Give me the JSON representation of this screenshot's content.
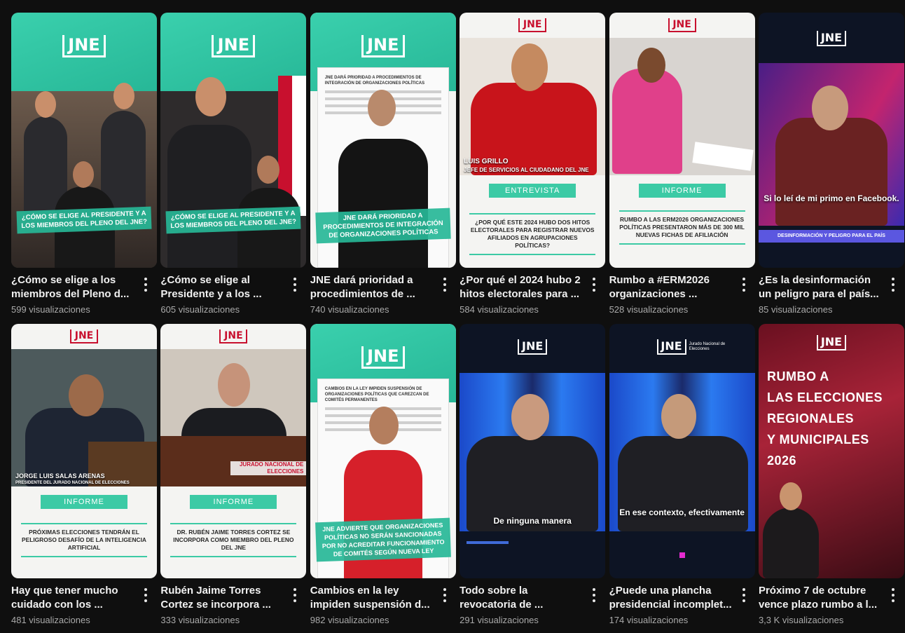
{
  "videos": [
    {
      "title": "¿Cómo se elige a los miembros del Pleno d...",
      "views": "599 visualizaciones",
      "thumb": {
        "logo": "JNE",
        "banner": "¿CÓMO SE ELIGE AL PRESIDENTE Y A LOS MIEMBROS DEL PLENO DEL JNE?"
      }
    },
    {
      "title": "¿Cómo se elige al Presidente y a los ...",
      "views": "605 visualizaciones",
      "thumb": {
        "logo": "JNE",
        "banner": "¿CÓMO SE ELIGE AL PRESIDENTE Y A LOS MIEMBROS DEL PLENO DEL JNE?"
      }
    },
    {
      "title": "JNE dará prioridad a procedimientos de ...",
      "views": "740 visualizaciones",
      "thumb": {
        "logo": "JNE",
        "doc_header": "JNE DARÁ PRIORIDAD A PROCEDIMIENTOS DE INTEGRACIÓN DE ORGANIZACIONES POLÍTICAS",
        "banner": "JNE DARÁ PRIORIDAD A PROCEDIMIENTOS DE INTEGRACIÓN DE ORGANIZACIONES POLÍTICAS"
      }
    },
    {
      "title": "¿Por qué el 2024 hubo 2 hitos electorales para ...",
      "views": "584 visualizaciones",
      "thumb": {
        "logo": "JNE",
        "caption": "LUIS GRILLO",
        "caption2": "JEFE DE SERVICIOS AL CIUDADANO DEL JNE",
        "pill": "ENTREVISTA",
        "info": "¿POR QUÉ ESTE 2024 HUBO DOS HITOS ELECTORALES PARA REGISTRAR NUEVOS AFILIADOS EN AGRUPACIONES POLÍTICAS?"
      }
    },
    {
      "title": "Rumbo a #ERM2026 organizaciones ...",
      "views": "528 visualizaciones",
      "thumb": {
        "logo": "JNE",
        "pill": "INFORME",
        "info": "RUMBO A LAS ERM2026 ORGANIZACIONES POLÍTICAS PRESENTARON MÁS DE 300 MIL NUEVAS FICHAS DE AFILIACIÓN"
      }
    },
    {
      "title": "¿Es la desinformación un peligro para el país...",
      "views": "85 visualizaciones",
      "thumb": {
        "logo": "JNE",
        "subtitle": "Si lo leí de mi primo en Facebook.",
        "strap": "DESINFORMACIÓN Y PELIGRO PARA EL PAÍS"
      }
    },
    {
      "title": "Hay que tener mucho cuidado con los ...",
      "views": "481 visualizaciones",
      "thumb": {
        "logo": "JNE",
        "caption": "JORGE LUIS SALAS ARENAS",
        "caption2": "PRESIDENTE DEL JURADO NACIONAL DE ELECCIONES",
        "pill": "INFORME",
        "info": "PRÓXIMAS ELECCIONES TENDRÁN EL PELIGROSO DESAFÍO DE LA INTELIGENCIA ARTIFICIAL"
      }
    },
    {
      "title": "Rubén Jaime Torres Cortez se incorpora ...",
      "views": "333 visualizaciones",
      "thumb": {
        "logo": "JNE",
        "podium": "JURADO NACIONAL DE ELECCIONES",
        "pill": "INFORME",
        "info": "DR. RUBÉN JAIME TORRES CORTEZ SE INCORPORA COMO MIEMBRO DEL PLENO DEL JNE"
      }
    },
    {
      "title": "Cambios en la ley impiden suspensión d...",
      "views": "982 visualizaciones",
      "thumb": {
        "logo": "JNE",
        "doc_header": "CAMBIOS EN LA LEY IMPIDEN SUSPENSIÓN DE ORGANIZACIONES POLÍTICAS QUE CAREZCAN DE COMITÉS PERMANENTES",
        "banner": "JNE ADVIERTE QUE ORGANIZACIONES POLÍTICAS NO SERÁN SANCIONADAS POR NO ACREDITAR FUNCIONAMIENTO DE COMITÉS SEGÚN NUEVA LEY"
      }
    },
    {
      "title": "Todo sobre la revocatoria de ...",
      "views": "291 visualizaciones",
      "thumb": {
        "logo": "JNE",
        "subtitle": "De ninguna manera"
      }
    },
    {
      "title": "¿Puede una plancha presidencial incomplet...",
      "views": "174 visualizaciones",
      "thumb": {
        "logo": "JNE",
        "logo_text": "Jurado Nacional de Elecciones",
        "subtitle": "En ese contexto, efectivamente"
      }
    },
    {
      "title": "Próximo 7 de octubre vence plazo rumbo a l...",
      "views": "3,3 K visualizaciones",
      "thumb": {
        "logo": "JNE",
        "big_lines": [
          "RUMBO A",
          "LAS ELECCIONES",
          "REGIONALES",
          "Y MUNICIPALES",
          "2026"
        ]
      }
    }
  ],
  "colors": {
    "background": "#0f0f0f",
    "title": "#f1f1f1",
    "views": "#aaaaaa",
    "jne_teal": "#27b797",
    "jne_red": "#c8102e"
  }
}
